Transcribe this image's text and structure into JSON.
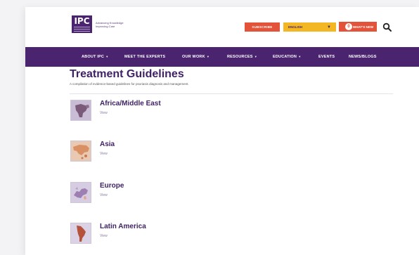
{
  "header": {
    "logo_text": "IPC",
    "logo_tagline": "Advancing Knowledge Improving Care",
    "subscribe_label": "SUBSCRIBE",
    "language_value": "ENGLISH",
    "whats_new_label": "WHAT'S NEW",
    "whats_new_count": "0"
  },
  "nav": {
    "items": [
      {
        "label": "ABOUT IPC",
        "dropdown": true
      },
      {
        "label": "MEET THE EXPERTS",
        "dropdown": false
      },
      {
        "label": "OUR WORK",
        "dropdown": true
      },
      {
        "label": "RESOURCES",
        "dropdown": true
      },
      {
        "label": "EDUCATION",
        "dropdown": true
      },
      {
        "label": "EVENTS",
        "dropdown": false
      },
      {
        "label": "NEWS/BLOGS",
        "dropdown": false
      }
    ],
    "dropdown_glyph": "▾"
  },
  "main": {
    "title": "Treatment Guidelines",
    "subtitle": "A compilation of evidence-based guidelines for psoriasis diagnosis and management.",
    "regions": [
      {
        "name": "Africa/Middle East",
        "link": "View",
        "icon": "africa-map-icon"
      },
      {
        "name": "Asia",
        "link": "View",
        "icon": "asia-map-icon"
      },
      {
        "name": "Europe",
        "link": "View",
        "icon": "europe-map-icon"
      },
      {
        "name": "Latin America",
        "link": "View",
        "icon": "latin-america-map-icon"
      }
    ]
  },
  "colors": {
    "brand_purple": "#4b2470",
    "accent_orange": "#e2533a",
    "accent_yellow": "#f2b722"
  }
}
